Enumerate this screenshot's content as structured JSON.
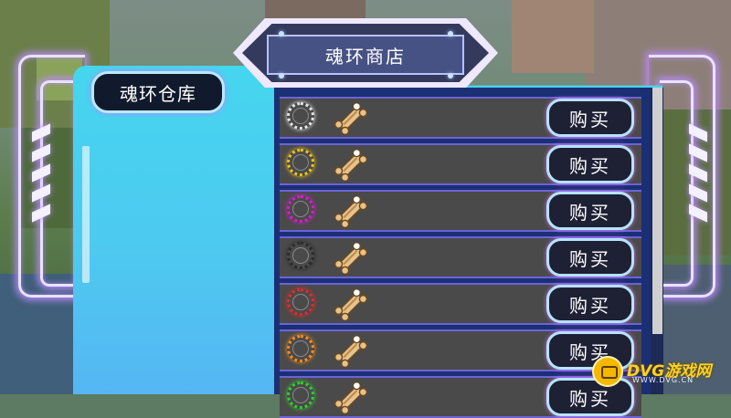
{
  "title": "魂环商店",
  "stock_tab_label": "魂环仓库",
  "buy_label": "购买",
  "rows": [
    {
      "ring_color": "#e6e6e6"
    },
    {
      "ring_color": "#f0c419"
    },
    {
      "ring_color": "#d91bd1"
    },
    {
      "ring_color": "#2a2a2a"
    },
    {
      "ring_color": "#e52a2a"
    },
    {
      "ring_color": "#ff8c1a"
    },
    {
      "ring_color": "#2fd12f"
    }
  ],
  "watermark": {
    "text": "DVG游戏网",
    "sub": "WWW.DVG.CN"
  }
}
